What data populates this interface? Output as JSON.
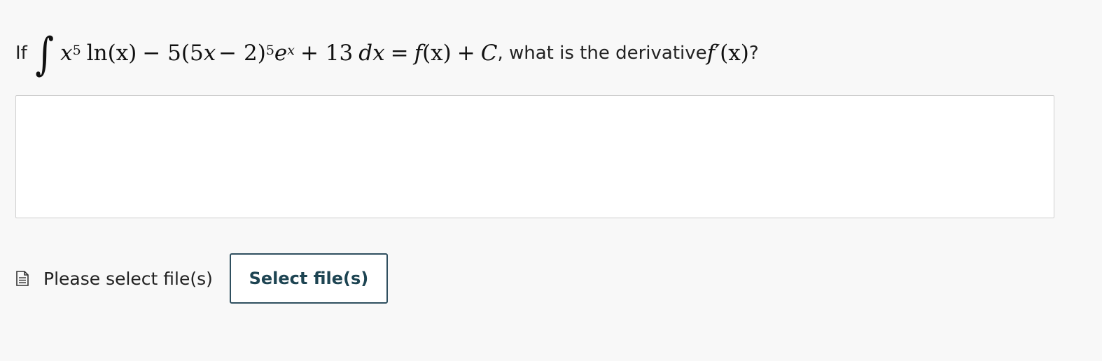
{
  "question": {
    "prefix": "If",
    "integral_symbol": "∫",
    "integrand_x": "x",
    "integrand_pow1": "5",
    "ln": "ln",
    "ln_arg": "(x)",
    "minus_term": "− 5(5",
    "minus_x": "x",
    "minus_tail": "− 2)",
    "pow2": "5",
    "exp_base": "e",
    "exp_pow": "x",
    "plus_const": "+ 13",
    "dx": "dx",
    "equals": "=",
    "f": "f",
    "f_arg": "(x)",
    "plus_c": "+",
    "c": "C",
    "suffix": ", what is the derivative ",
    "fprime": "f′",
    "fprime_arg": "(x)",
    "qmark": "?"
  },
  "answer": {
    "value": ""
  },
  "file_upload": {
    "status_label": "Please select file(s)",
    "button_label": "Select file(s)"
  },
  "icons": {
    "file_icon": "document-icon"
  }
}
